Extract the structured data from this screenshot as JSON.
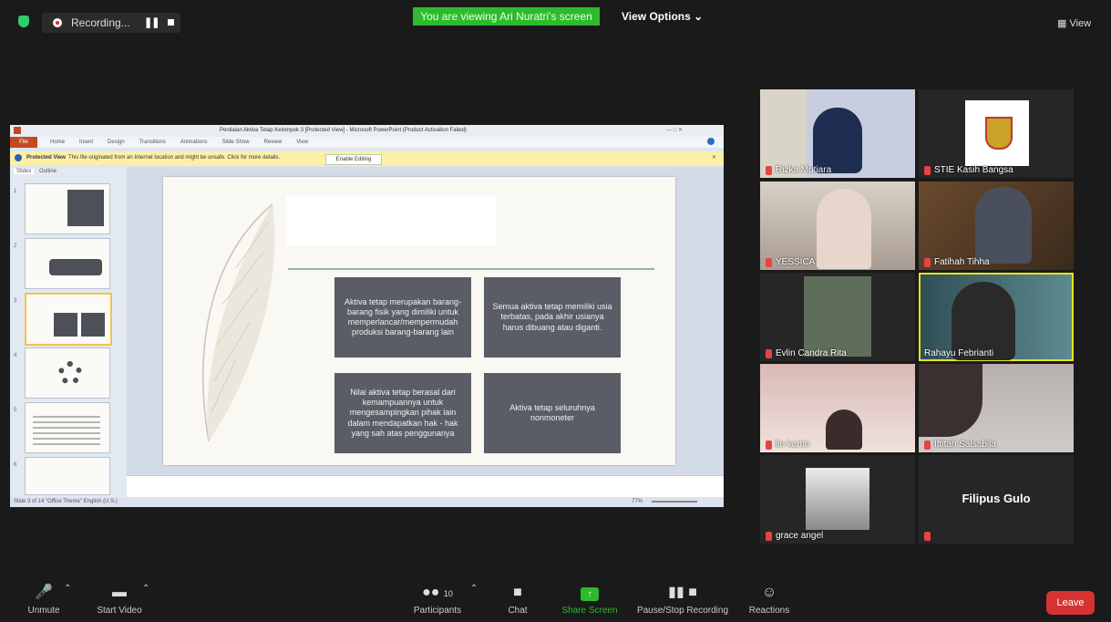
{
  "topbar": {
    "recording_label": "Recording...",
    "banner_text": "You are viewing Ari Nuratri's screen",
    "view_options_label": "View Options",
    "view_label": "View"
  },
  "ppt": {
    "title": "Penilaian Aktiva Tetap Kelompok 3 [Protected View] - Microsoft PowerPoint (Product Activation Failed)",
    "file_tab": "File",
    "tabs": [
      "Home",
      "Insert",
      "Design",
      "Transitions",
      "Animations",
      "Slide Show",
      "Review",
      "View"
    ],
    "msg_title": "Protected View",
    "msg_text": "This file originated from an Internet location and might be unsafe. Click for more details.",
    "enable_editing": "Enable Editing",
    "panel_tabs": [
      "Slides",
      "Outline"
    ],
    "thumb_numbers": [
      "1",
      "2",
      "3",
      "4",
      "5",
      "6"
    ],
    "status_left": "Slide 3 of 14   \"Office Theme\"   English (U.S.)",
    "zoom": "77%",
    "boxes": [
      "Aktiva tetap merupakan barang-barang fisik yang dimiliki untuk memperlancar/mempermudah produksi barang-barang lain",
      "Semua aktiva tetap memiliki usia terbatas, pada akhir usianya harus dibuang atau diganti.",
      "Nilai aktiva tetap berasal dari kemampuannya untuk mengesampingkan pihak lain dalam mendapatkan hak - hak yang sah atas penggunanya",
      "Aktiva tetap seluruhnya nonmoneter"
    ]
  },
  "participants": [
    {
      "name": "Rizka Mutiara",
      "bg": "#8a93a3"
    },
    {
      "name": "STIE Kasih Bangsa",
      "bg": "#1f1f1f"
    },
    {
      "name": "YESSICA",
      "bg": "#b9aaa0"
    },
    {
      "name": "Fatihah Tihha",
      "bg": "#5a3b28"
    },
    {
      "name": "Evlin Candra Rita",
      "bg": "#3a3a3a"
    },
    {
      "name": "Rahayu Febrianti",
      "bg": "#4e6f77"
    },
    {
      "name": "lin kartin",
      "bg": "#c7a9a6"
    },
    {
      "name": "Iftitah Salsabila",
      "bg": "#a9a3a2"
    },
    {
      "name": "grace angel",
      "bg": "#262626"
    },
    {
      "name": "",
      "bg": "#262626",
      "display_name": "Filipus Gulo"
    }
  ],
  "toolbar": {
    "unmute": "Unmute",
    "start_video": "Start Video",
    "participants": "Participants",
    "participants_count": "10",
    "chat": "Chat",
    "share_screen": "Share Screen",
    "pause_recording": "Pause/Stop Recording",
    "reactions": "Reactions",
    "leave": "Leave"
  }
}
